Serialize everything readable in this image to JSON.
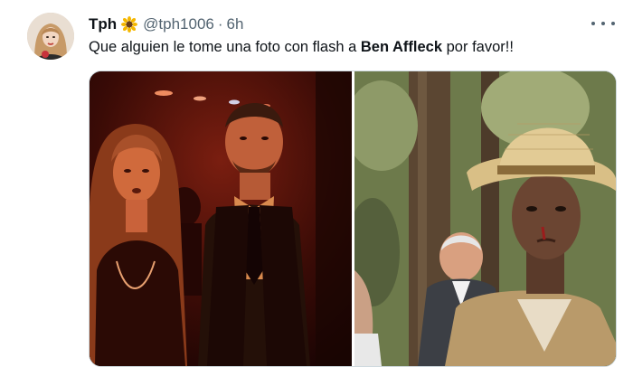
{
  "tweet": {
    "display_name": "Tph",
    "name_emoji": "sunflower-icon",
    "handle": "@tph1006",
    "separator": "·",
    "timestamp": "6h",
    "text_part1": "Que alguien le tome una foto con flash a ",
    "text_bold": "Ben Affleck",
    "text_part2": " por favor!!"
  },
  "media": {
    "count": 2,
    "left_photo": "red-lit-event-photo",
    "right_photo": "outdoor-man-in-straw-hat-photo"
  },
  "colors": {
    "text_primary": "#0f1419",
    "text_secondary": "#536471",
    "border": "#cfd9de"
  }
}
